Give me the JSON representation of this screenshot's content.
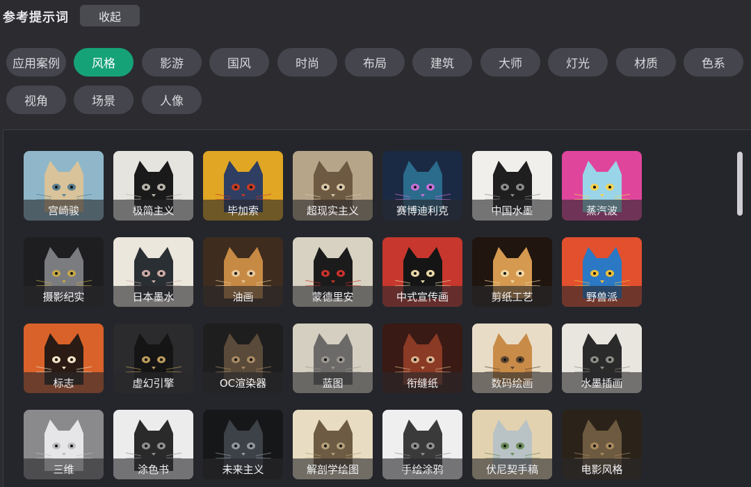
{
  "header": {
    "title": "参考提示词",
    "collapse_label": "收起"
  },
  "tabs": [
    {
      "label": "应用案例",
      "active": false
    },
    {
      "label": "风格",
      "active": true
    },
    {
      "label": "影游",
      "active": false
    },
    {
      "label": "国风",
      "active": false
    },
    {
      "label": "时尚",
      "active": false
    },
    {
      "label": "布局",
      "active": false
    },
    {
      "label": "建筑",
      "active": false
    },
    {
      "label": "大师",
      "active": false
    },
    {
      "label": "灯光",
      "active": false
    },
    {
      "label": "材质",
      "active": false
    },
    {
      "label": "色系",
      "active": false
    },
    {
      "label": "视角",
      "active": false
    },
    {
      "label": "场景",
      "active": false
    },
    {
      "label": "人像",
      "active": false
    }
  ],
  "styles": [
    {
      "label": "宫崎骏",
      "icon": "cat-ghibli-illustration",
      "bg": "#8fb7c9",
      "fg": "#d9c39a",
      "accent": "#5a7f8f"
    },
    {
      "label": "极简主义",
      "icon": "cat-minimalist-black",
      "bg": "#e6e4df",
      "fg": "#1a1a1a",
      "accent": "#b8b4aa"
    },
    {
      "label": "毕加索",
      "icon": "cat-cubist-face",
      "bg": "#e0a624",
      "fg": "#2f3e63",
      "accent": "#c43c26"
    },
    {
      "label": "超现实主义",
      "icon": "cat-surreal",
      "bg": "#b7a58a",
      "fg": "#6e5a42",
      "accent": "#d9c7a8"
    },
    {
      "label": "赛博迪利克",
      "icon": "cat-cyber-psychedelic",
      "bg": "#1b2a44",
      "fg": "#2b6b8c",
      "accent": "#c56fd6"
    },
    {
      "label": "中国水墨",
      "icon": "cat-ink-wash",
      "bg": "#f0efec",
      "fg": "#1f1f1f",
      "accent": "#8a8a8a"
    },
    {
      "label": "蒸汽波",
      "icon": "cat-vaporwave",
      "bg": "#e0459c",
      "fg": "#9ad4e8",
      "accent": "#f5d24f"
    },
    {
      "label": "摄影纪实",
      "icon": "cat-photo-gray",
      "bg": "#1e1e20",
      "fg": "#7b7c80",
      "accent": "#c5a84a"
    },
    {
      "label": "日本墨水",
      "icon": "cat-japanese-ink",
      "bg": "#ece7dc",
      "fg": "#2a2f33",
      "accent": "#c9a9a3"
    },
    {
      "label": "油画",
      "icon": "cat-oil-painting",
      "bg": "#3e2c1e",
      "fg": "#c78a45",
      "accent": "#e8c89a"
    },
    {
      "label": "蒙德里安",
      "icon": "cat-mondrian",
      "bg": "#d8d2c2",
      "fg": "#1b1b1b",
      "accent": "#c8322b"
    },
    {
      "label": "中式宣传画",
      "icon": "cat-propaganda",
      "bg": "#c7372d",
      "fg": "#151515",
      "accent": "#e7d6a6"
    },
    {
      "label": "剪纸工艺",
      "icon": "cat-papercut",
      "bg": "#20150f",
      "fg": "#d59a50",
      "accent": "#f2d8a4"
    },
    {
      "label": "野兽派",
      "icon": "cat-fauvism",
      "bg": "#e2502e",
      "fg": "#2b78c4",
      "accent": "#f0c13b"
    },
    {
      "label": "标志",
      "icon": "cat-logo-emblem",
      "bg": "#d9622a",
      "fg": "#2a1b14",
      "accent": "#f3e0c4"
    },
    {
      "label": "虚幻引擎",
      "icon": "cat-unreal-render",
      "bg": "#2b2b2d",
      "fg": "#151516",
      "accent": "#b99a5b"
    },
    {
      "label": "OC渲染器",
      "icon": "cat-octane-render",
      "bg": "#1e1e1f",
      "fg": "#5a4a3a",
      "accent": "#a88a63"
    },
    {
      "label": "蓝图",
      "icon": "cat-blueprint-sketch",
      "bg": "#d5cfc2",
      "fg": "#6b6a68",
      "accent": "#9a968e"
    },
    {
      "label": "衔缝纸",
      "icon": "cat-quilled-paper",
      "bg": "#3a1a14",
      "fg": "#8a3a25",
      "accent": "#d9b089"
    },
    {
      "label": "数码绘画",
      "icon": "cat-digital-painting",
      "bg": "#e8dcc6",
      "fg": "#c98b48",
      "accent": "#5c4530"
    },
    {
      "label": "水墨插画",
      "icon": "cat-ink-illustration",
      "bg": "#e9e6df",
      "fg": "#2a2a2a",
      "accent": "#8c8a85"
    },
    {
      "label": "三维",
      "icon": "cat-3d-white",
      "bg": "#8a8a8c",
      "fg": "#e6e6e8",
      "accent": "#bfbfc2"
    },
    {
      "label": "涂色书",
      "icon": "cat-coloring-book",
      "bg": "#ececec",
      "fg": "#2a2a2a",
      "accent": "#8e8e8e"
    },
    {
      "label": "未来主义",
      "icon": "cat-futurist-armor",
      "bg": "#161718",
      "fg": "#3d4148",
      "accent": "#8e96a0"
    },
    {
      "label": "解剖学绘图",
      "icon": "cat-anatomy-drawing",
      "bg": "#e8dcc2",
      "fg": "#6d5c43",
      "accent": "#b49f7a"
    },
    {
      "label": "手绘涂鸦",
      "icon": "cat-hand-drawn",
      "bg": "#efefef",
      "fg": "#3a3a3a",
      "accent": "#8f8f8f"
    },
    {
      "label": "伏尼契手稿",
      "icon": "cat-voynich-manuscript",
      "bg": "#e3d2b0",
      "fg": "#b9c3c6",
      "accent": "#6d8d5a"
    },
    {
      "label": "电影风格",
      "icon": "cat-cinematic",
      "bg": "#2b2319",
      "fg": "#6d5a40",
      "accent": "#a88a5c"
    }
  ]
}
